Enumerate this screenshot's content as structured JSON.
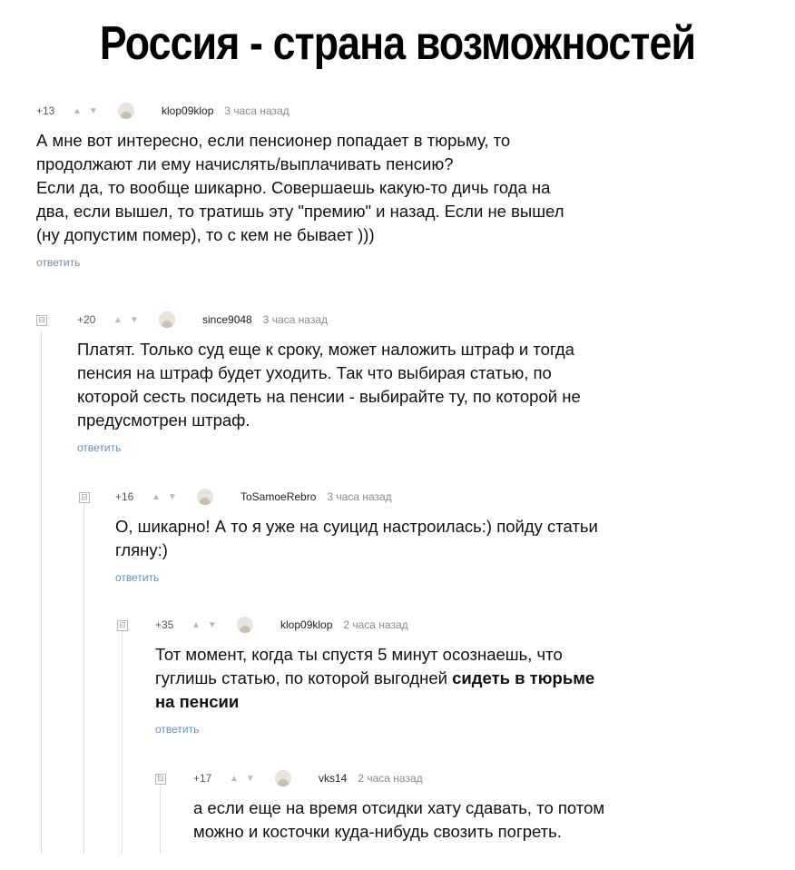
{
  "title": "Россия - страна возможностей",
  "comments": [
    {
      "score": "+13",
      "user": "klop09klop",
      "time": "3 часа назад",
      "text_lines": [
        "А мне вот интересно, если пенсионер попадает в тюрьму, то",
        "продолжают ли ему начислять/выплачивать пенсию?",
        "Если да, то вообще шикарно. Совершаешь какую-то дичь года на",
        "два, если вышел, то тратишь эту \"премию\"  и назад. Если не вышел",
        "(ну допустим помер), то с кем не бывает )))"
      ],
      "reply": "ответить"
    },
    {
      "score": "+20",
      "user": "since9048",
      "time": "3 часа назад",
      "text_lines": [
        "Платят. Только суд еще к сроку, может наложить штраф и тогда",
        "пенсия на штраф будет уходить. Так что выбирая статью, по",
        "которой сесть посидеть на пенсии - выбирайте ту, по которой не",
        "предусмотрен штраф."
      ],
      "reply": "ответить"
    },
    {
      "score": "+16",
      "user": "ToSamoeRebro",
      "time": "3 часа назад",
      "text_lines": [
        "О, шикарно! А то я уже на суицид настроилась:) пойду статьи",
        "гляну:)"
      ],
      "reply": "ответить"
    },
    {
      "score": "+35",
      "user": "klop09klop",
      "time": "2 часа назад",
      "text_line1": "Тот момент, когда ты спустя 5 минут осознаешь, что",
      "text_line2_plain": "гуглишь статью, по которой выгодней ",
      "text_line2_bold": "сидеть в тюрьме",
      "text_line3_bold": "на пенсии",
      "reply": "ответить"
    },
    {
      "score": "+17",
      "user": "vks14",
      "time": "2 часа назад",
      "text_lines": [
        "а если еще на время отсидки хату сдавать, то потом",
        "можно и косточки куда-нибудь свозить погреть."
      ]
    }
  ],
  "icons": {
    "collapse": "⊟",
    "arrow_up": "▲",
    "arrow_down": "▼"
  }
}
